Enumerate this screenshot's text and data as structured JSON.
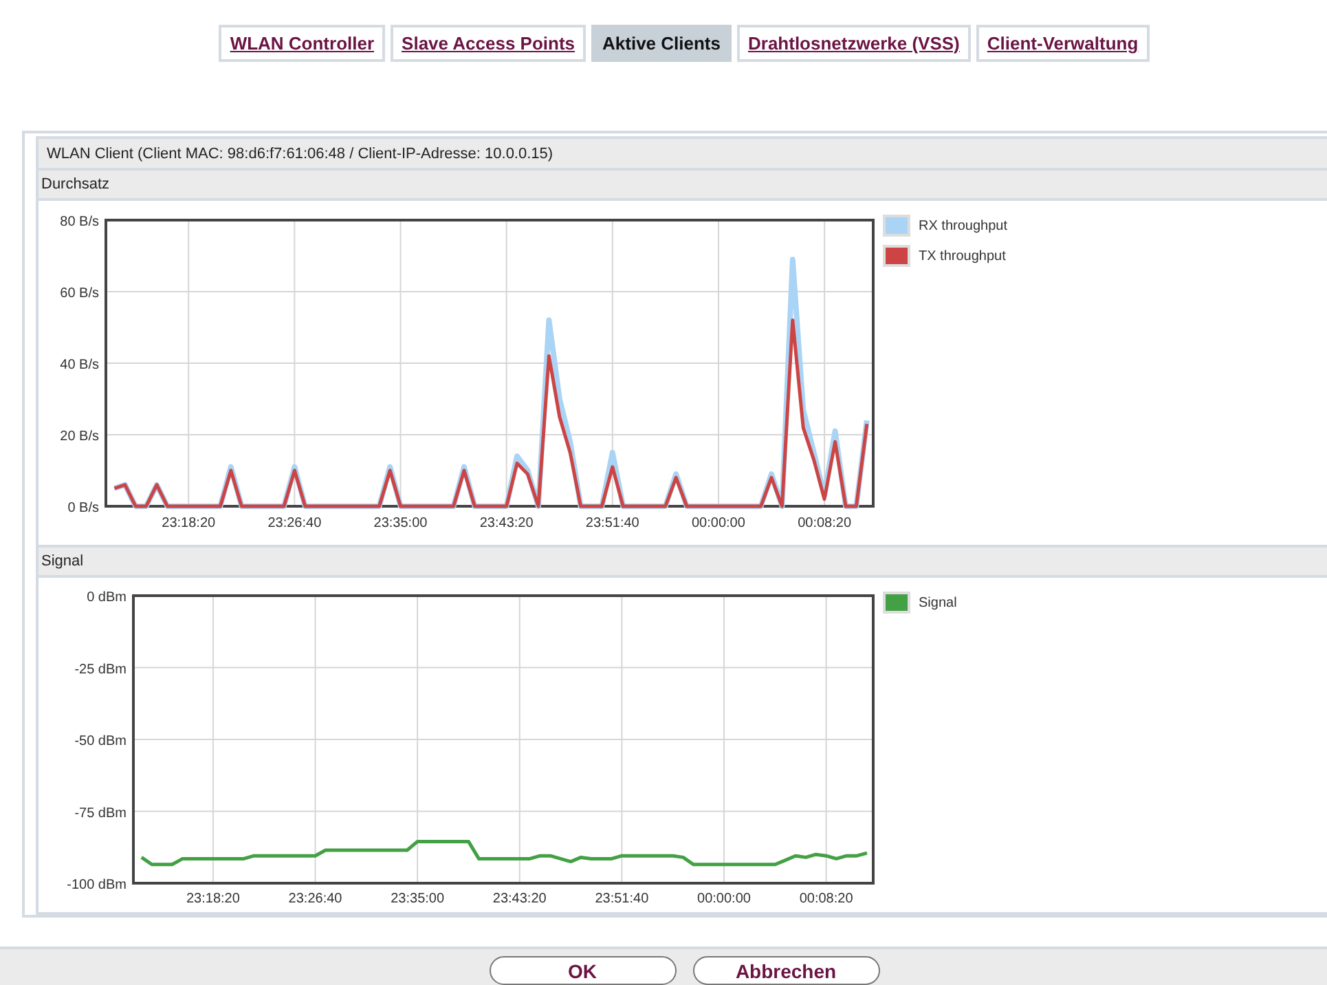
{
  "tabs": [
    {
      "label": "WLAN Controller",
      "selected": false
    },
    {
      "label": "Slave Access Points",
      "selected": false
    },
    {
      "label": "Aktive Clients",
      "selected": true
    },
    {
      "label": "Drahtlosnetzwerke (VSS)",
      "selected": false
    },
    {
      "label": "Client-Verwaltung",
      "selected": false
    }
  ],
  "panel": {
    "title": "WLAN Client (Client MAC: 98:d6:f7:61:06:48 / Client-IP-Adresse: 10.0.0.15)",
    "sections": [
      {
        "heading": "Durchsatz",
        "chart_data": {
          "type": "line",
          "grid": true,
          "categories": [
            null,
            null,
            null,
            null,
            null,
            null,
            null,
            "23:18:20",
            null,
            null,
            null,
            null,
            null,
            null,
            null,
            null,
            null,
            "23:26:40",
            null,
            null,
            null,
            null,
            null,
            null,
            null,
            null,
            null,
            "23:35:00",
            null,
            null,
            null,
            null,
            null,
            null,
            null,
            null,
            null,
            "23:43:20",
            null,
            null,
            null,
            null,
            null,
            null,
            null,
            null,
            null,
            "23:51:40",
            null,
            null,
            null,
            null,
            null,
            null,
            null,
            null,
            null,
            "00:00:00",
            null,
            null,
            null,
            null,
            null,
            null,
            null,
            null,
            null,
            "00:08:20",
            null,
            null,
            null,
            null
          ],
          "series": [
            {
              "name": "RX throughput",
              "color": "#aad4f5",
              "values": [
                5,
                6,
                0,
                0,
                6,
                0,
                0,
                0,
                0,
                0,
                0,
                11,
                0,
                0,
                0,
                0,
                0,
                11,
                0,
                0,
                0,
                0,
                0,
                0,
                0,
                0,
                11,
                0,
                0,
                0,
                0,
                0,
                0,
                11,
                0,
                0,
                0,
                0,
                14,
                10,
                0,
                52,
                30,
                18,
                0,
                0,
                0,
                15,
                0,
                0,
                0,
                0,
                0,
                9,
                0,
                0,
                0,
                0,
                0,
                0,
                0,
                0,
                9,
                0,
                69,
                27,
                15,
                3,
                21,
                0,
                0,
                24
              ]
            },
            {
              "name": "TX throughput",
              "color": "#cc4444",
              "values": [
                5,
                6,
                0,
                0,
                6,
                0,
                0,
                0,
                0,
                0,
                0,
                10,
                0,
                0,
                0,
                0,
                0,
                10,
                0,
                0,
                0,
                0,
                0,
                0,
                0,
                0,
                10,
                0,
                0,
                0,
                0,
                0,
                0,
                10,
                0,
                0,
                0,
                0,
                12,
                9,
                0,
                42,
                25,
                15,
                0,
                0,
                0,
                11,
                0,
                0,
                0,
                0,
                0,
                8,
                0,
                0,
                0,
                0,
                0,
                0,
                0,
                0,
                8,
                0,
                52,
                22,
                13,
                2,
                18,
                0,
                0,
                23
              ]
            }
          ],
          "ylim": [
            0,
            80
          ],
          "yticks": [
            {
              "value": 0,
              "label": "0 B/s"
            },
            {
              "value": 20,
              "label": "20 B/s"
            },
            {
              "value": 40,
              "label": "40 B/s"
            },
            {
              "value": 60,
              "label": "60 B/s"
            },
            {
              "value": 80,
              "label": "80 B/s"
            }
          ]
        }
      },
      {
        "heading": "Signal",
        "chart_data": {
          "type": "line",
          "grid": true,
          "categories": [
            null,
            null,
            null,
            null,
            null,
            null,
            null,
            "23:18:20",
            null,
            null,
            null,
            null,
            null,
            null,
            null,
            null,
            null,
            "23:26:40",
            null,
            null,
            null,
            null,
            null,
            null,
            null,
            null,
            null,
            "23:35:00",
            null,
            null,
            null,
            null,
            null,
            null,
            null,
            null,
            null,
            "23:43:20",
            null,
            null,
            null,
            null,
            null,
            null,
            null,
            null,
            null,
            "23:51:40",
            null,
            null,
            null,
            null,
            null,
            null,
            null,
            null,
            null,
            "00:00:00",
            null,
            null,
            null,
            null,
            null,
            null,
            null,
            null,
            null,
            "00:08:20",
            null,
            null,
            null,
            null
          ],
          "series": [
            {
              "name": "Signal",
              "color": "#44a044",
              "values": [
                -91,
                -93.5,
                -93.5,
                -93.5,
                -91.5,
                -91.5,
                -91.5,
                -91.5,
                -91.5,
                -91.5,
                -91.5,
                -90.5,
                -90.5,
                -90.5,
                -90.5,
                -90.5,
                -90.5,
                -90.5,
                -88.5,
                -88.5,
                -88.5,
                -88.5,
                -88.5,
                -88.5,
                -88.5,
                -88.5,
                -88.5,
                -85.5,
                -85.5,
                -85.5,
                -85.5,
                -85.5,
                -85.5,
                -91.5,
                -91.5,
                -91.5,
                -91.5,
                -91.5,
                -91.5,
                -90.5,
                -90.5,
                -91.5,
                -92.5,
                -91,
                -91.5,
                -91.5,
                -91.5,
                -90.5,
                -90.5,
                -90.5,
                -90.5,
                -90.5,
                -90.5,
                -91,
                -93.5,
                -93.5,
                -93.5,
                -93.5,
                -93.5,
                -93.5,
                -93.5,
                -93.5,
                -93.5,
                -92,
                -90.5,
                -91,
                -90,
                -90.5,
                -91.5,
                -90.5,
                -90.5,
                -89.5
              ]
            }
          ],
          "ylim": [
            -100,
            0
          ],
          "yticks": [
            {
              "value": -100,
              "label": "-100 dBm"
            },
            {
              "value": -75,
              "label": "-75 dBm"
            },
            {
              "value": -50,
              "label": "-50 dBm"
            },
            {
              "value": -25,
              "label": "-25 dBm"
            },
            {
              "value": 0,
              "label": "0 dBm"
            }
          ]
        }
      }
    ]
  },
  "buttons": [
    {
      "label": "OK"
    },
    {
      "label": "Abbrechen"
    }
  ]
}
